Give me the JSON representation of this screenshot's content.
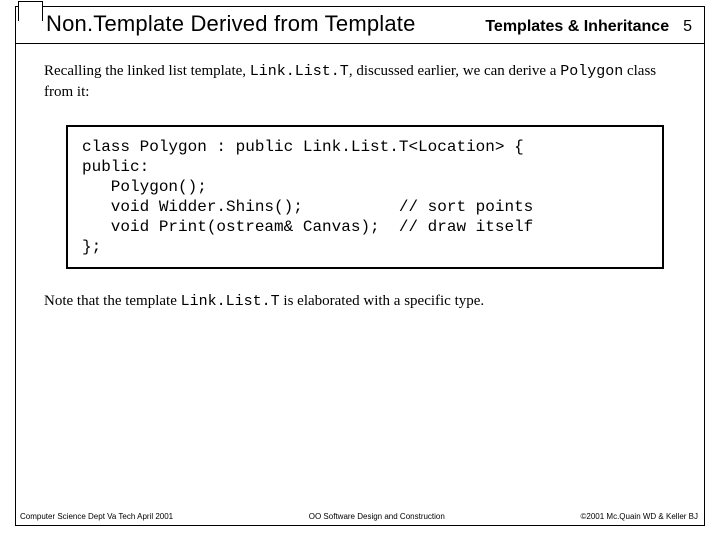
{
  "header": {
    "title": "Non.Template Derived from Template",
    "section": "Templates & Inheritance",
    "page": "5"
  },
  "intro": {
    "t1": "Recalling the linked list template, ",
    "code1": "Link.List.T",
    "t2": ", discussed earlier, we can derive a ",
    "code2": "Polygon",
    "t3": " class from it:"
  },
  "code": "class Polygon : public Link.List.T<Location> {\npublic:\n   Polygon();\n   void Widder.Shins();          // sort points\n   void Print(ostream& Canvas);  // draw itself\n};",
  "note": {
    "t1": "Note that the template ",
    "code1": "Link.List.T",
    "t2": " is elaborated with a specific type."
  },
  "footer": {
    "left": "Computer Science Dept Va Tech April 2001",
    "center": "OO Software Design and Construction",
    "right": "©2001 Mc.Quain WD & Keller BJ"
  }
}
